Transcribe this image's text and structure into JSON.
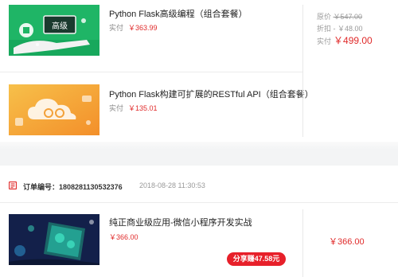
{
  "orders": [
    {
      "items": [
        {
          "title": "Python Flask高级编程（组合套餐）",
          "paid_label": "实付",
          "paid_value": "￥363.99",
          "thumb_icon": "python-chalkboard-illustration",
          "thumb_text": "高级"
        },
        {
          "title": "Python Flask构建可扩展的RESTful API（组合套餐）",
          "paid_label": "实付",
          "paid_value": "￥135.01",
          "thumb_icon": "cloud-plugin-illustration"
        }
      ],
      "summary": {
        "original_label": "原价",
        "original_value": "￥547.00",
        "discount_label": "折扣",
        "discount_value": "- ￥48.00",
        "paid_label": "实付",
        "paid_value": "￥499.00"
      }
    },
    {
      "header": {
        "order_no_label": "订单编号：1808281130532376",
        "time": "2018-08-28 11:30:53",
        "icon": "order-document-icon"
      },
      "items": [
        {
          "title": "纯正商业级应用-微信小程序开发实战",
          "paid_value": "￥366.00",
          "thumb_icon": "wechat-miniprogram-illustration",
          "share_label": "分享赚47.58元"
        }
      ],
      "summary": {
        "paid_value": "￥366.00"
      }
    }
  ],
  "colors": {
    "accent_red": "#e02a2a",
    "share_red": "#e7202a",
    "thumb_green": "#1fb566",
    "thumb_orange": "#f8a53a",
    "thumb_navy": "#13204a"
  }
}
